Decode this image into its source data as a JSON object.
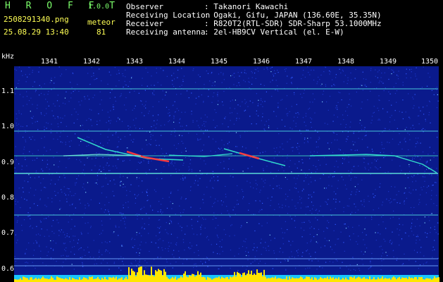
{
  "app": {
    "name": "H R O F F T",
    "version": "1.0.0"
  },
  "file": {
    "name": "2508291340.png",
    "timestamp": "25.08.29 13:40"
  },
  "meteor": {
    "label": "meteor",
    "count": "81"
  },
  "info": [
    {
      "key": "Observer",
      "value": ": Takanori Kawachi"
    },
    {
      "key": "Receiving Location",
      "value": ": Ogaki, Gifu, JAPAN (136.60E, 35.35N)"
    },
    {
      "key": "Receiver",
      "value": ": R820T2(RTL-SDR) SDR-Sharp 53.1000MHz"
    },
    {
      "key": "Receiving antenna",
      "value": ": 2el-HB9CV Vertical (el. E-W)"
    }
  ],
  "spectrogram": {
    "y_unit": "kHz",
    "y_ticks": [
      "1.1",
      "1.0",
      "0.9",
      "0.8",
      "0.7",
      "0.6"
    ],
    "x_ticks": [
      "1341",
      "1342",
      "1343",
      "1344",
      "1345",
      "1346",
      "1347",
      "1348",
      "1349",
      "1350"
    ],
    "colors": {
      "background": "#0a1a8c",
      "noise": "#2f58ff",
      "line": "#35e6d0",
      "hot": "#ff3b3b",
      "bar": "#ffe600"
    }
  }
}
